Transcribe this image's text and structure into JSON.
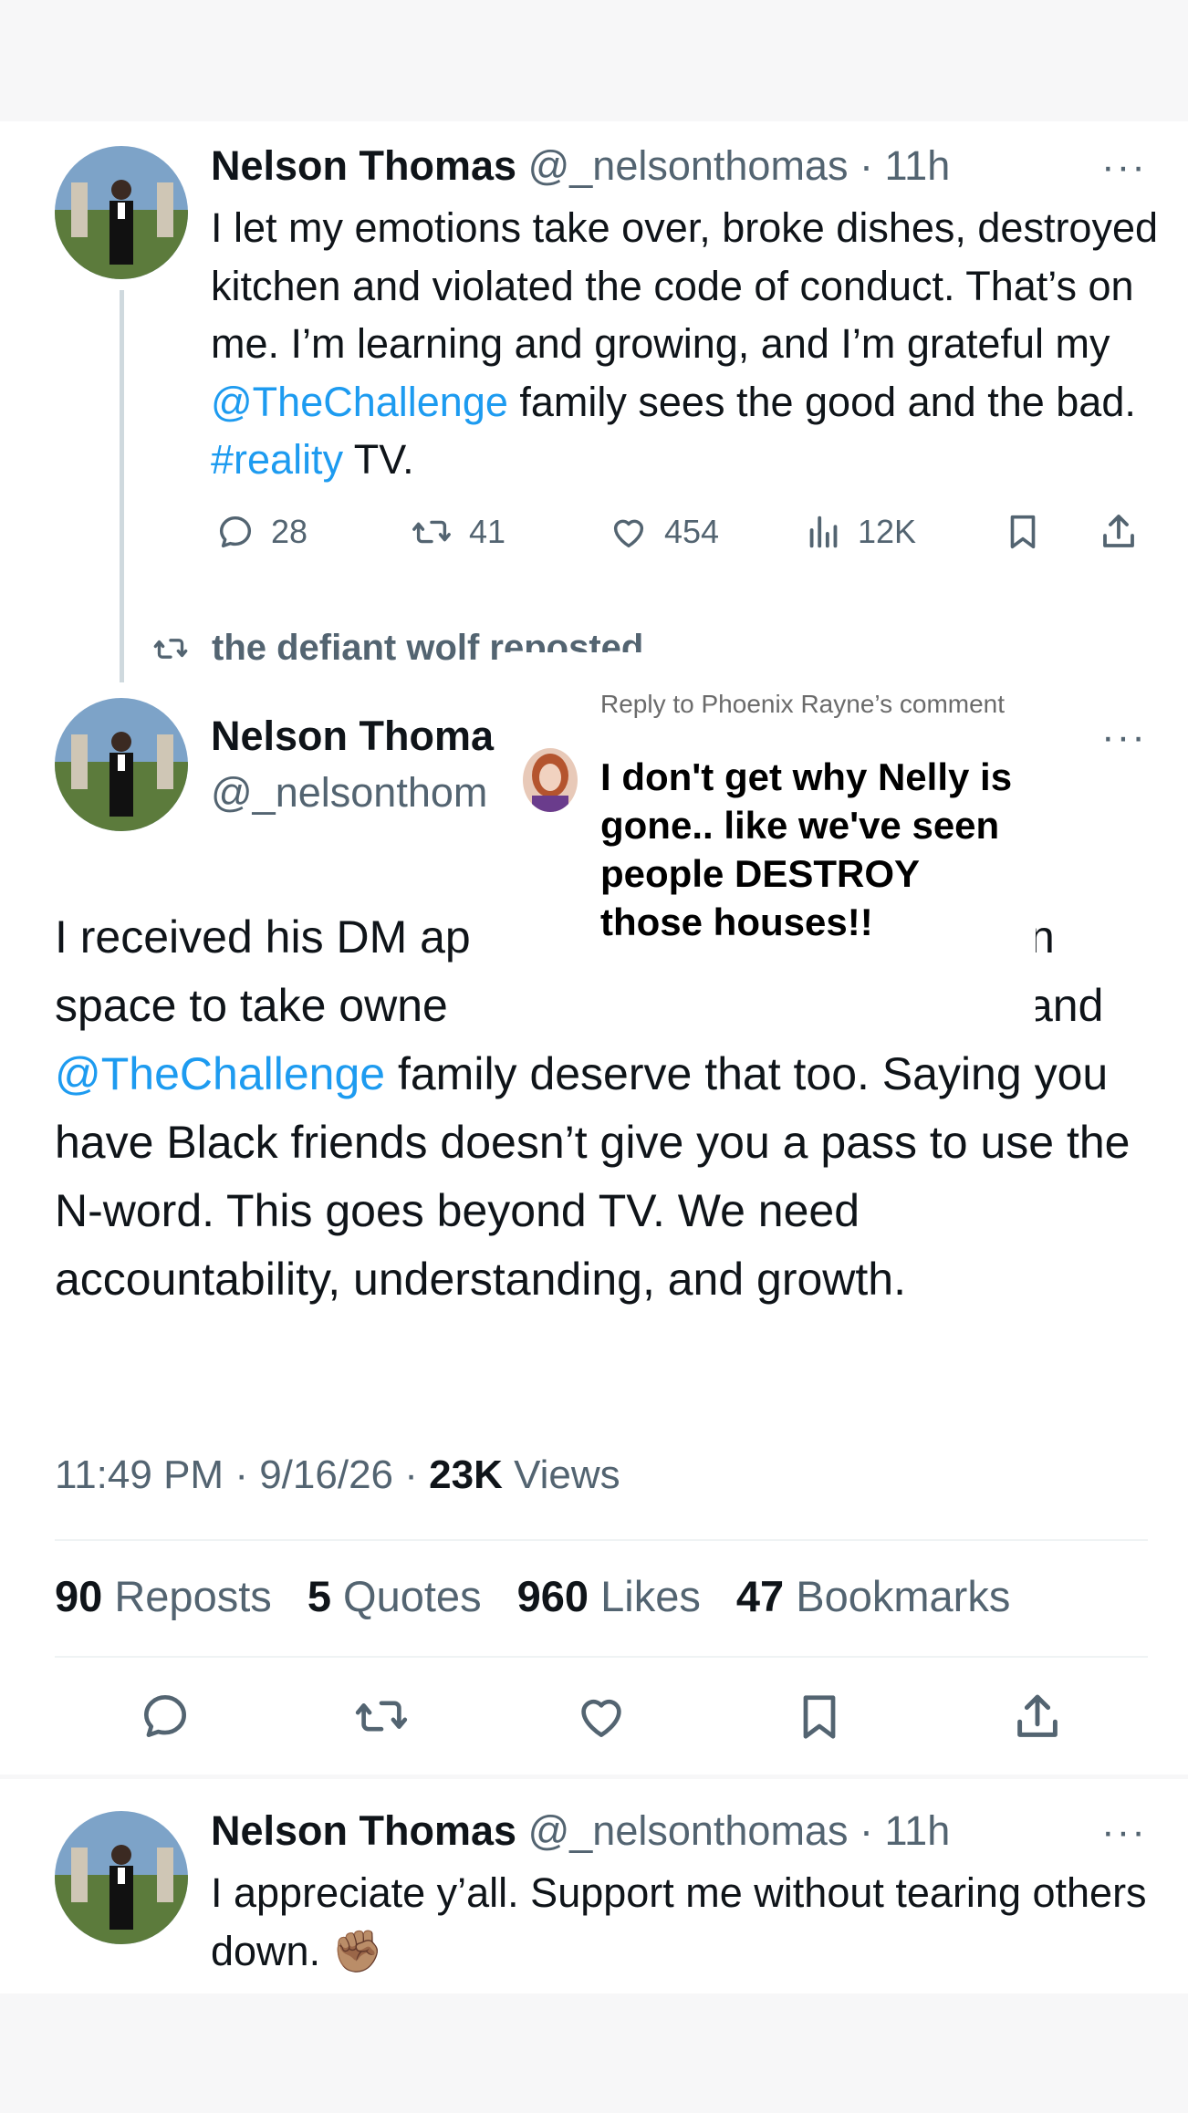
{
  "tweet1": {
    "name": "Nelson Thomas",
    "handle": "@_nelsonthomas",
    "time": "11h",
    "dot": "·",
    "more": "···",
    "text_a": "I let my emotions take over, broke dishes, destroyed kitchen and violated the code of conduct. That’s on me. I’m learning and growing, and I’m grateful my ",
    "mention": "@TheChallenge",
    "text_b": " family sees the good and the bad. ",
    "hashtag": "#reality",
    "text_c": " TV.",
    "replies": "28",
    "reposts": "41",
    "likes": "454",
    "views": "12K"
  },
  "repost_notice": "the defiant wolf reposted",
  "main_tweet": {
    "name": "Nelson Thoma",
    "handle": "@_nelsonthom",
    "more": "···",
    "line1_a": "I received his DM ap",
    "line1_b": "n",
    "line2_a": "space to take owne",
    "line2_b": "and",
    "mention": "@TheChallenge",
    "rest": " family deserve that too. Saying you have Black friends doesn’t give you a pass to use the N-word. This goes beyond TV. We need accountability, understanding, and growth.",
    "time": "11:49 PM",
    "date": "9/16/26",
    "dot": "·",
    "views_count": "23K",
    "views_label": "Views",
    "stats": [
      {
        "count": "90",
        "label": "Reposts"
      },
      {
        "count": "5",
        "label": "Quotes"
      },
      {
        "count": "960",
        "label": "Likes"
      },
      {
        "count": "47",
        "label": "Bookmarks"
      }
    ]
  },
  "overlay": {
    "reply_to": "Reply to Phoenix Rayne’s comment",
    "comment": "I don't get why Nelly is gone.. like we've seen people DESTROY those houses!!"
  },
  "tweet3": {
    "name": "Nelson Thomas",
    "handle": "@_nelsonthomas",
    "time": "11h",
    "dot": "·",
    "more": "···",
    "text": "I appreciate y’all. Support me without tearing others down.",
    "emoji": "✊🏽"
  },
  "colors": {
    "link": "#1d9bf0",
    "muted": "#536471",
    "text": "#0f1419",
    "divider": "#eff3f4",
    "page_bg": "#f7f7f8"
  },
  "icons": [
    "reply-icon",
    "repost-icon",
    "like-icon",
    "views-icon",
    "bookmark-icon",
    "share-icon",
    "more-icon"
  ]
}
